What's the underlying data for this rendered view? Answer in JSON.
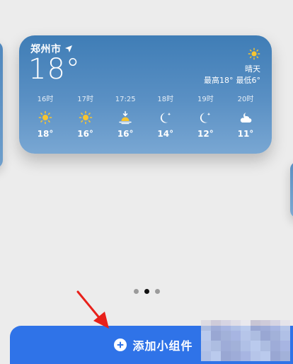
{
  "weather_widget": {
    "city": "郑州市",
    "temperature": "18°",
    "condition": "晴天",
    "high": "最高18°",
    "low": "最低6°",
    "hourly": [
      {
        "time": "16时",
        "icon": "sun-icon",
        "temp": "18°"
      },
      {
        "time": "17时",
        "icon": "sun-icon",
        "temp": "16°"
      },
      {
        "time": "17:25",
        "icon": "sunset-icon",
        "temp": "16°"
      },
      {
        "time": "18时",
        "icon": "moon-star-icon",
        "temp": "14°"
      },
      {
        "time": "19时",
        "icon": "moon-star-icon",
        "temp": "12°"
      },
      {
        "time": "20时",
        "icon": "cloudy-night-icon",
        "temp": "11°"
      }
    ]
  },
  "page_indicator": {
    "count": 3,
    "active_index": 1
  },
  "add_widget": {
    "label": "添加小组件"
  },
  "colors": {
    "widget_top": "#3f7db6",
    "widget_bottom": "#79a7d3",
    "button": "#2f73e8",
    "arrow": "#e8201a",
    "sun": "#f7c531"
  }
}
